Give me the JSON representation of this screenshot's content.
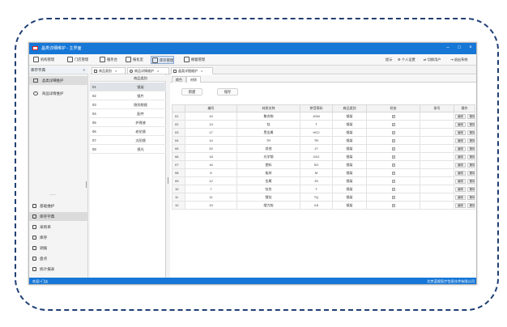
{
  "window": {
    "title": "晶类详细维护 - 主界面",
    "minimize": "–",
    "maximize": "□",
    "close": "×"
  },
  "toolbar": {
    "items": [
      {
        "label": "机构管理"
      },
      {
        "label": "门店管理"
      },
      {
        "label": "服务台"
      },
      {
        "label": "报化室"
      },
      {
        "label": "库存管理"
      },
      {
        "label": "桐督管理"
      }
    ],
    "right": [
      {
        "label": "提示"
      },
      {
        "label": "个人设置"
      },
      {
        "label": "切换用户"
      },
      {
        "label": "退出系统"
      }
    ]
  },
  "sidebar": {
    "header": "库存字典",
    "collapse": "<",
    "items": [
      {
        "label": "晶类详细维护"
      },
      {
        "label": "商品详情维护"
      }
    ],
    "nav": [
      {
        "label": "基础维护"
      },
      {
        "label": "库存字典"
      },
      {
        "label": "采购单"
      },
      {
        "label": "库存"
      },
      {
        "label": "调拨"
      },
      {
        "label": "盘点"
      },
      {
        "label": "统计报表"
      }
    ],
    "separator": "——"
  },
  "doc_tabs": [
    {
      "label": "商品类别"
    },
    {
      "label": "商品详情维护"
    },
    {
      "label": "晶类详细维护"
    }
  ],
  "category_panel": {
    "header": "商品类别",
    "rows": [
      {
        "no": "01",
        "name": "镜架"
      },
      {
        "no": "02",
        "name": "镜片"
      },
      {
        "no": "03",
        "name": "隐形眼镜"
      },
      {
        "no": "04",
        "name": "配件"
      },
      {
        "no": "05",
        "name": "护理液"
      },
      {
        "no": "06",
        "name": "老花镜"
      },
      {
        "no": "07",
        "name": "太阳镜"
      },
      {
        "no": "08",
        "name": "视光"
      }
    ]
  },
  "sub_tabs": [
    {
      "label": "颜色"
    },
    {
      "label": "材质"
    }
  ],
  "buttons": {
    "new": "新建",
    "save": "保存"
  },
  "table": {
    "columns": [
      "",
      "编号",
      "材质名称",
      "拼音简码",
      "商品类别",
      "状态",
      "排号",
      "操作"
    ],
    "op_labels": [
      "编辑",
      "删除"
    ],
    "rows": [
      {
        "idx": "01",
        "code": "19",
        "name": "聚合物",
        "py": "JGW",
        "cat": "镜架"
      },
      {
        "idx": "02",
        "code": "13",
        "name": "钛",
        "py": "T",
        "cat": "镜架"
      },
      {
        "idx": "03",
        "code": "17",
        "name": "黑金属",
        "py": "HGJ",
        "cat": "镜架"
      },
      {
        "idx": "04",
        "code": "14",
        "name": "TR",
        "py": "TR",
        "cat": "镜架"
      },
      {
        "idx": "05",
        "code": "20",
        "name": "其他",
        "py": "JT",
        "cat": "镜架"
      },
      {
        "idx": "06",
        "code": "18",
        "name": "光学钢",
        "py": "GXJ",
        "cat": "镜架"
      },
      {
        "idx": "07",
        "code": "16",
        "name": "塑料",
        "py": "SG",
        "cat": "镜架"
      },
      {
        "idx": "08",
        "code": "6",
        "name": "板材",
        "py": "M",
        "cat": "镜架"
      },
      {
        "idx": "09",
        "code": "12",
        "name": "金属",
        "py": "JS",
        "cat": "镜架"
      },
      {
        "idx": "10",
        "code": "7",
        "name": "钛合",
        "py": "T",
        "cat": "镜架"
      },
      {
        "idx": "11",
        "code": "11",
        "name": "镀钛",
        "py": "TQ",
        "cat": "镜架"
      },
      {
        "idx": "12",
        "code": "15",
        "name": "缕力韵",
        "py": "XJI",
        "cat": "镜架"
      }
    ]
  },
  "statusbar": {
    "left": "欢迎~门店",
    "right": "北京蓝视医疗信息技术有限公司"
  }
}
